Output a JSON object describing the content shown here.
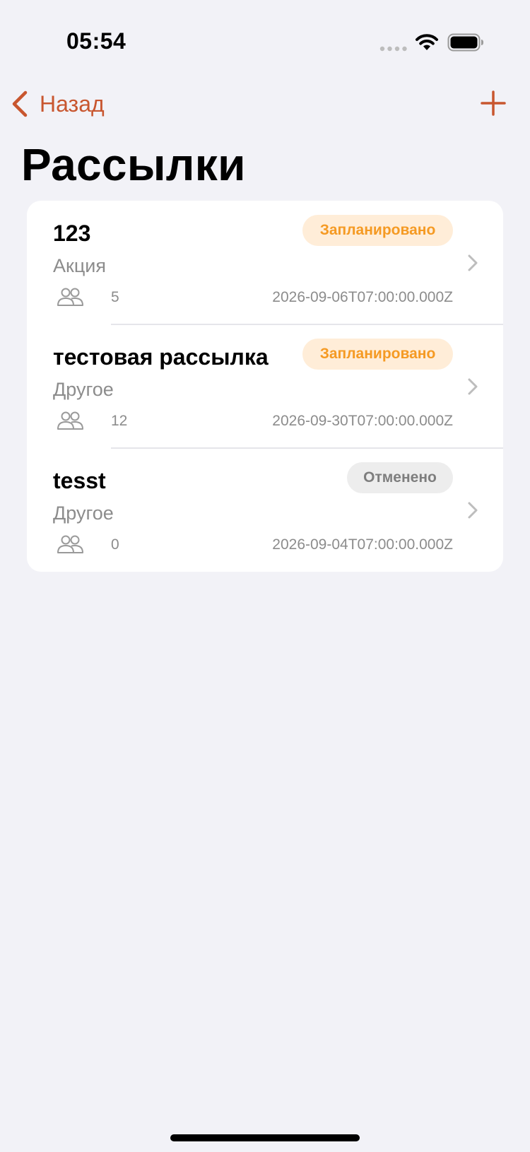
{
  "status_bar": {
    "time": "05:54"
  },
  "nav": {
    "back_label": "Назад",
    "title": "Рассылки"
  },
  "colors": {
    "accent": "#C8562F",
    "background": "#F2F2F7",
    "planned_badge_bg": "#FFEDD8",
    "planned_badge_text": "#F59A23",
    "cancelled_badge_bg": "#EDEDED",
    "cancelled_badge_text": "#7E7E7E"
  },
  "mailings": [
    {
      "title": "123",
      "status": "Запланировано",
      "category": "Акция",
      "recipients": "5",
      "date": "2026-09-06T07:00:00.000Z"
    },
    {
      "title": "тестовая рассылка",
      "status": "Запланировано",
      "category": "Другое",
      "recipients": "12",
      "date": "2026-09-30T07:00:00.000Z"
    },
    {
      "title": "tesst",
      "status": "Отменено",
      "category": "Другое",
      "recipients": "0",
      "date": "2026-09-04T07:00:00.000Z"
    }
  ]
}
